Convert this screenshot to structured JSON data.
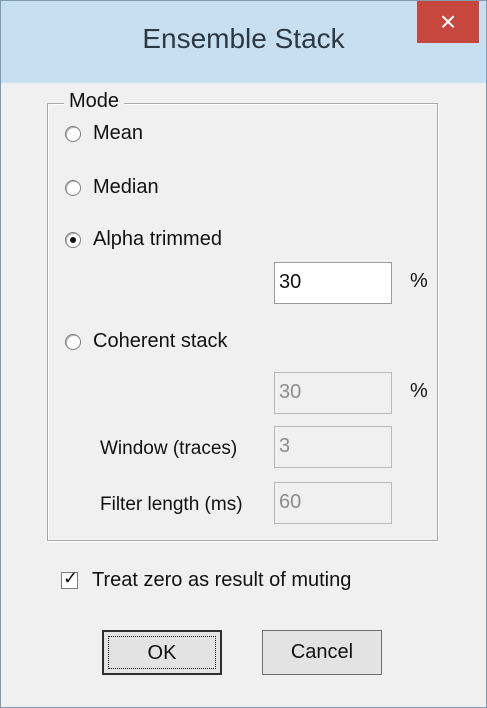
{
  "window": {
    "title": "Ensemble Stack",
    "close_icon": "×"
  },
  "mode": {
    "label": "Mode",
    "options": [
      {
        "label": "Mean",
        "selected": false
      },
      {
        "label": "Median",
        "selected": false
      },
      {
        "label": "Alpha trimmed",
        "selected": true
      },
      {
        "label": "Coherent stack",
        "selected": false
      }
    ],
    "alpha_value": "30",
    "percent_unit": "%",
    "coherent_value": "30",
    "window_label": "Window (traces)",
    "window_value": "3",
    "filter_label": "Filter length (ms)",
    "filter_value": "60"
  },
  "checkbox": {
    "label": "Treat zero as result of muting",
    "checked": true
  },
  "buttons": {
    "ok": "OK",
    "cancel": "Cancel"
  }
}
